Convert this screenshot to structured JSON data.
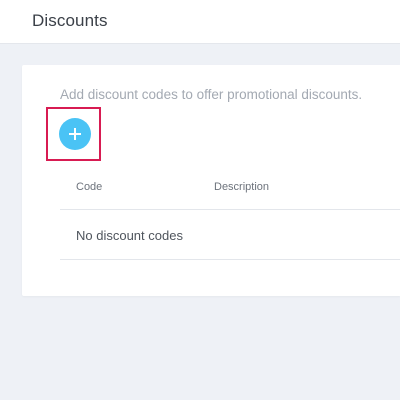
{
  "header": {
    "title": "Discounts"
  },
  "card": {
    "hint": "Add discount codes to offer promotional discounts.",
    "add_button": {
      "icon": "plus-icon",
      "color": "#4ac3f5",
      "highlight_color": "#d81b52"
    },
    "table": {
      "columns": [
        "Code",
        "Description"
      ],
      "empty_message": "No discount codes"
    }
  }
}
